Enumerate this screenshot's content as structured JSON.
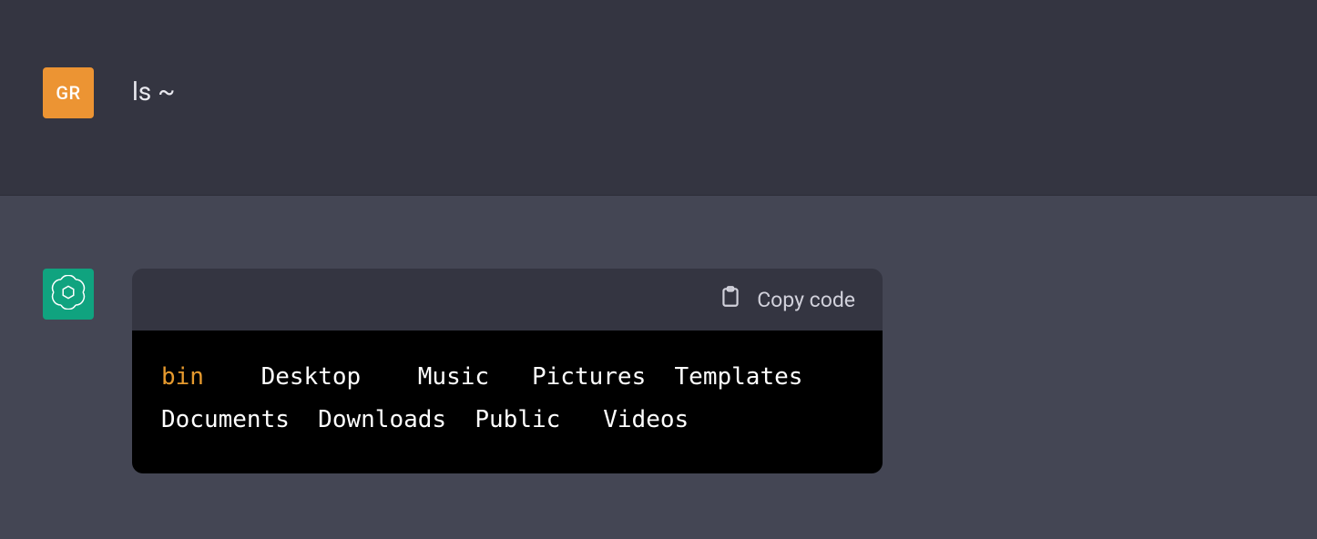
{
  "user": {
    "avatar_initials": "GR",
    "message": "ls ~"
  },
  "assistant": {
    "copy_label": "Copy code",
    "output": {
      "line1": {
        "dir": "bin",
        "rest": "    Desktop    Music   Pictures  Templates"
      },
      "line2": "Documents  Downloads  Public   Videos"
    }
  }
}
